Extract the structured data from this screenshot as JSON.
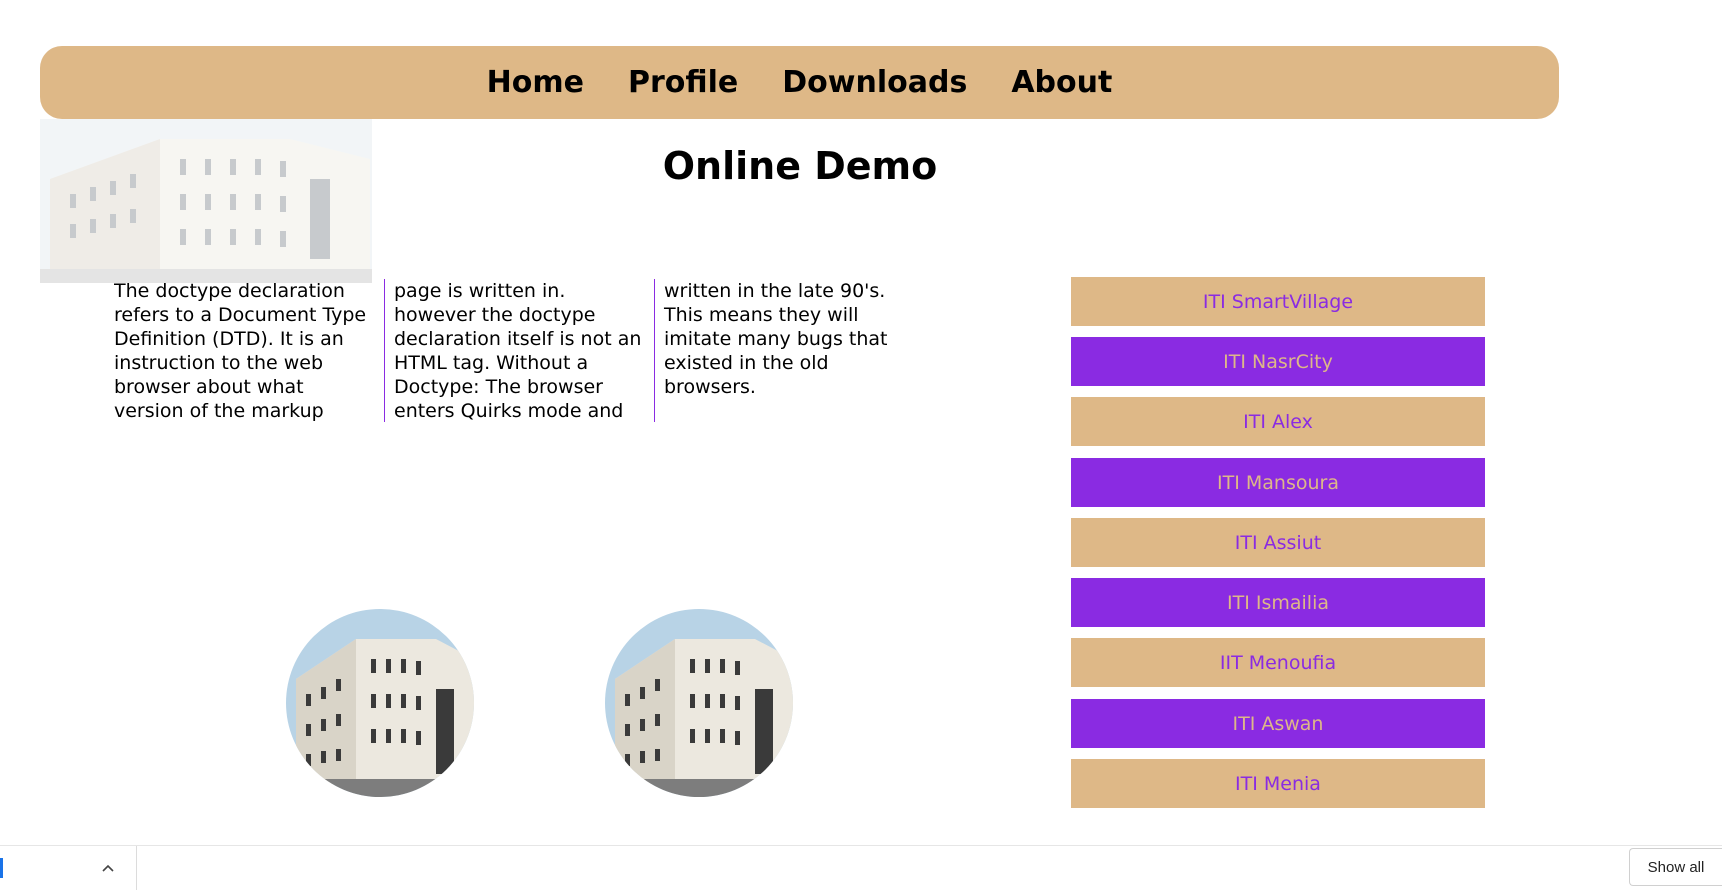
{
  "nav": {
    "items": [
      {
        "label": "Home"
      },
      {
        "label": "Profile"
      },
      {
        "label": "Downloads"
      },
      {
        "label": "About"
      }
    ]
  },
  "title": "Online Demo",
  "article": {
    "columns": [
      "The doctype declaration refers to a Document Type Definition (DTD). It is an instruction to the web browser about what version of the markup language the",
      "page is written in. however the doctype declaration itself is not an HTML tag. Without a Doctype: The browser enters Quirks mode and tries to deal with your code as if it was",
      "written in the late 90's. This means they will imitate many bugs that existed in the old browsers."
    ]
  },
  "branches": [
    {
      "label": "ITI SmartVillage",
      "style": "tan"
    },
    {
      "label": "ITI NasrCity",
      "style": "purple"
    },
    {
      "label": "ITI Alex",
      "style": "tan"
    },
    {
      "label": "ITI Mansoura",
      "style": "purple"
    },
    {
      "label": "ITI Assiut",
      "style": "tan"
    },
    {
      "label": "ITI Ismailia",
      "style": "purple"
    },
    {
      "label": "IIT Menoufia",
      "style": "tan"
    },
    {
      "label": "ITI Aswan",
      "style": "purple"
    },
    {
      "label": "ITI Menia",
      "style": "tan"
    }
  ],
  "colors": {
    "tan": "#deb887",
    "purple": "#8a2be2"
  },
  "downloads_bar": {
    "show_all_label": "Show all"
  }
}
